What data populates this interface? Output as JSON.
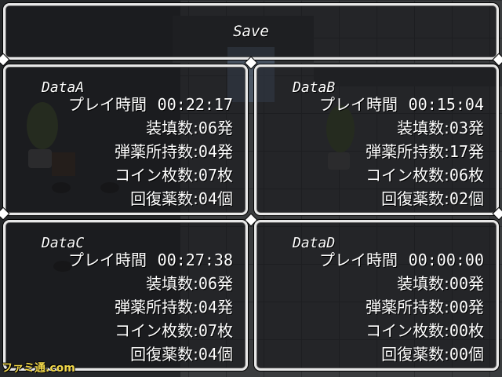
{
  "title": "Save",
  "slots": [
    {
      "name": "DataA",
      "playtime_label": "プレイ時間",
      "playtime": "00:22:17",
      "stats": [
        {
          "label": "装填数",
          "value": "06発"
        },
        {
          "label": "弾薬所持数",
          "value": "04発"
        },
        {
          "label": "コイン枚数",
          "value": "07枚"
        },
        {
          "label": "回復薬数",
          "value": "04個"
        }
      ]
    },
    {
      "name": "DataB",
      "playtime_label": "プレイ時間",
      "playtime": "00:15:04",
      "stats": [
        {
          "label": "装填数",
          "value": "03発"
        },
        {
          "label": "弾薬所持数",
          "value": "17発"
        },
        {
          "label": "コイン枚数",
          "value": "06枚"
        },
        {
          "label": "回復薬数",
          "value": "02個"
        }
      ]
    },
    {
      "name": "DataC",
      "playtime_label": "プレイ時間",
      "playtime": "00:27:38",
      "stats": [
        {
          "label": "装填数",
          "value": "06発"
        },
        {
          "label": "弾薬所持数",
          "value": "04発"
        },
        {
          "label": "コイン枚数",
          "value": "07枚"
        },
        {
          "label": "回復薬数",
          "value": "04個"
        }
      ]
    },
    {
      "name": "DataD",
      "playtime_label": "プレイ時間",
      "playtime": "00:00:00",
      "stats": [
        {
          "label": "装填数",
          "value": "00発"
        },
        {
          "label": "弾薬所持数",
          "value": "00発"
        },
        {
          "label": "コイン枚数",
          "value": "00枚"
        },
        {
          "label": "回復薬数",
          "value": "00個"
        }
      ]
    }
  ],
  "watermark": "ファミ通.com",
  "colors": {
    "frame": "#e8e8e8",
    "text": "#ffffff",
    "watermark": "#f2d84a"
  }
}
